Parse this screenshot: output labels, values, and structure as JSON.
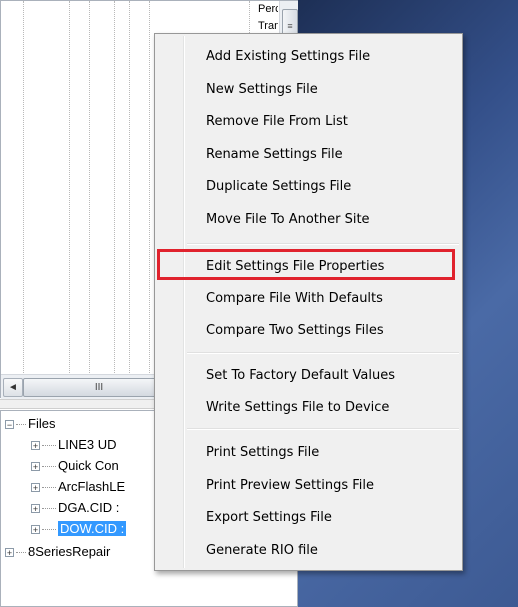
{
  "tree_snippet": [
    "Perce",
    "Trans"
  ],
  "scrollbars": {
    "vertical_thumb_glyph": "≡",
    "horizontal_thumb_glyph": "III",
    "left_arrow_glyph": "◄"
  },
  "tree": {
    "root_label": "Files",
    "items": [
      {
        "label": "LINE3 UD"
      },
      {
        "label": "Quick Con"
      },
      {
        "label": "ArcFlashLE"
      },
      {
        "label": "DGA.CID :"
      },
      {
        "label": "DOW.CID :"
      }
    ],
    "second_root_label": "8SeriesRepair",
    "expander_plus": "+",
    "expander_minus": "−"
  },
  "context_menu": {
    "items": [
      {
        "label": "Add Existing Settings File"
      },
      {
        "label": "New Settings File"
      },
      {
        "label": "Remove File From List"
      },
      {
        "label": "Rename Settings File"
      },
      {
        "label": "Duplicate Settings File"
      },
      {
        "label": "Move File To Another Site"
      },
      {
        "label": "Edit Settings File Properties"
      },
      {
        "label": "Compare File With Defaults"
      },
      {
        "label": "Compare Two Settings Files"
      },
      {
        "label": "Set To Factory Default Values"
      },
      {
        "label": "Write Settings File to Device"
      },
      {
        "label": "Print Settings File"
      },
      {
        "label": "Print Preview Settings File"
      },
      {
        "label": "Export Settings File"
      },
      {
        "label": "Generate RIO file"
      }
    ],
    "highlighted_index": 6
  },
  "colors": {
    "selection": "#3399ff",
    "highlight_box": "#e0222d",
    "menu_background": "#f0f0f0"
  }
}
